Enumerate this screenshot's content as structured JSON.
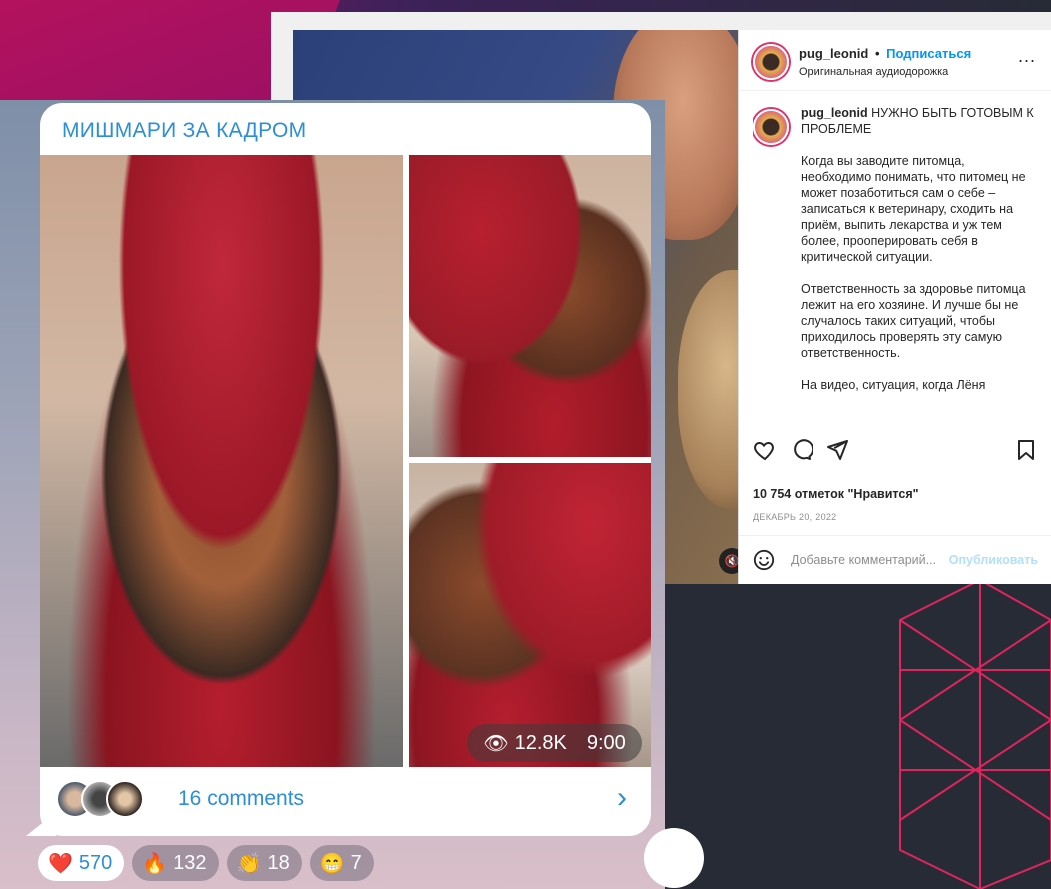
{
  "instagram": {
    "username": "pug_leonid",
    "dot": "•",
    "follow_label": "Подписаться",
    "audio": "Оригинальная аудиодорожка",
    "more": "...",
    "caption_title": "НУЖНО БЫТЬ ГОТОВЫМ К ПРОБЛЕМЕ",
    "para1": "Когда вы заводите питомца, необходимо понимать, что питомец не может позаботиться сам о себе – записаться к ветеринару, сходить на приём, выпить лекарства и уж тем более, прооперировать себя в критической ситуации.",
    "para2": "Ответственность за здоровье питомца лежит на его хозяине. И лучше бы не случалось таких ситуаций, чтобы приходилось проверять эту самую ответственность.",
    "para3": "На видео, ситуация, когда Лёня",
    "likes": "10 754 отметок \"Нравится\"",
    "date": "ДЕКАБРЬ 20, 2022",
    "comment_placeholder": "Добавьте комментарий...",
    "publish_label": "Опубликовать"
  },
  "telegram": {
    "title": "МИШМАРИ ЗА КАДРОМ",
    "views": "12.8K",
    "time": "9:00",
    "comments": "16 comments",
    "reactions": [
      {
        "emoji": "❤️",
        "count": "570",
        "own": true
      },
      {
        "emoji": "🔥",
        "count": "132",
        "own": false
      },
      {
        "emoji": "👏",
        "count": "18",
        "own": false
      },
      {
        "emoji": "😁",
        "count": "7",
        "own": false
      }
    ]
  },
  "colors": {
    "telegram_accent": "#2b8ed6",
    "instagram_link": "#0095f6",
    "background_dark": "#272b36",
    "magenta": "#b3125e"
  }
}
